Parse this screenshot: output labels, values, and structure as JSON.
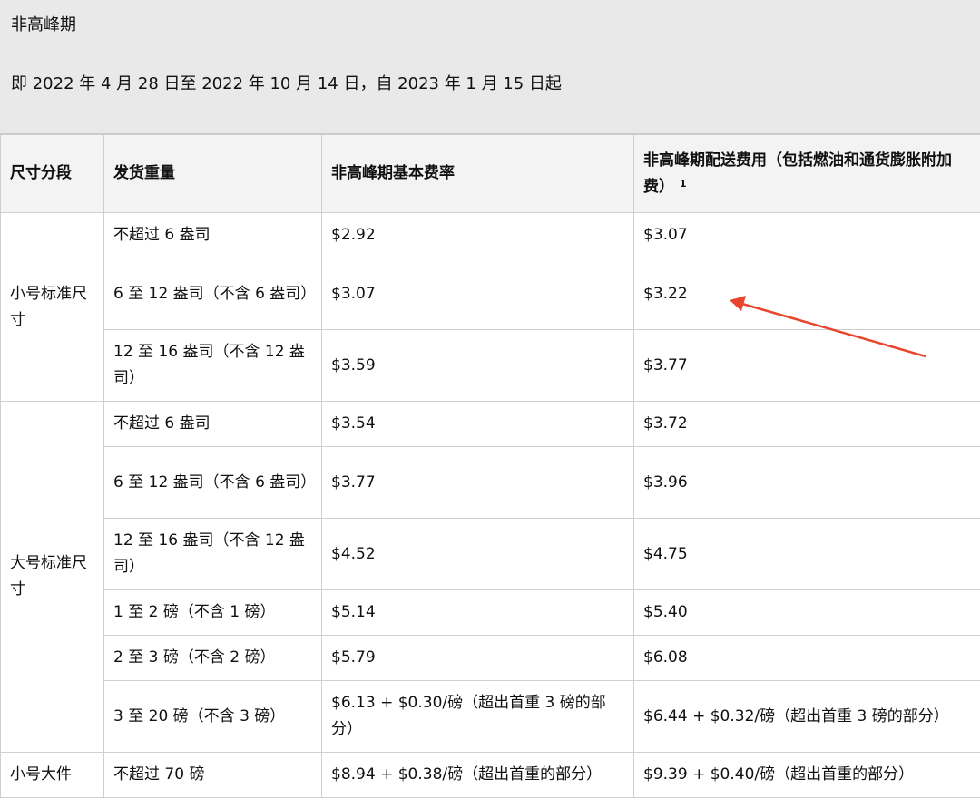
{
  "banner": {
    "title": "非高峰期",
    "subtitle": "即 2022 年 4 月 28 日至 2022 年 10 月 14 日，自 2023 年 1 月 15 日起"
  },
  "table": {
    "headers": [
      "尺寸分段",
      "发货重量",
      "非高峰期基本费率",
      "非高峰期配送费用（包括燃油和通货膨胀附加费）"
    ],
    "header_footnote": "1",
    "groups": [
      {
        "name": "小号标准尺寸",
        "rows": [
          {
            "weight": "不超过 6 盎司",
            "base": "$2.92",
            "fee": "$3.07"
          },
          {
            "weight": "6 至 12 盎司（不含 6 盎司）",
            "base": "$3.07",
            "fee": "$3.22"
          },
          {
            "weight": "12 至 16 盎司（不含 12 盎司）",
            "base": "$3.59",
            "fee": "$3.77"
          }
        ]
      },
      {
        "name": "大号标准尺寸",
        "rows": [
          {
            "weight": "不超过 6 盎司",
            "base": "$3.54",
            "fee": "$3.72"
          },
          {
            "weight": "6 至 12 盎司（不含 6 盎司）",
            "base": "$3.77",
            "fee": "$3.96"
          },
          {
            "weight": "12 至 16 盎司（不含 12 盎司）",
            "base": "$4.52",
            "fee": "$4.75"
          },
          {
            "weight": "1 至 2 磅（不含 1 磅）",
            "base": "$5.14",
            "fee": "$5.40"
          },
          {
            "weight": "2 至 3 磅（不含 2 磅）",
            "base": "$5.79",
            "fee": "$6.08"
          },
          {
            "weight": "3 至 20 磅（不含 3 磅）",
            "base": "$6.13 + $0.30/磅（超出首重 3 磅的部分）",
            "fee": "$6.44 + $0.32/磅（超出首重 3 磅的部分）"
          }
        ]
      },
      {
        "name": "小号大件",
        "rows": [
          {
            "weight": "不超过 70 磅",
            "base": "$8.94 + $0.38/磅（超出首重的部分）",
            "fee": "$9.39 + $0.40/磅（超出首重的部分）"
          }
        ]
      }
    ]
  },
  "annotation": {
    "color": "#e8452c",
    "icon": "red-arrow-icon"
  }
}
